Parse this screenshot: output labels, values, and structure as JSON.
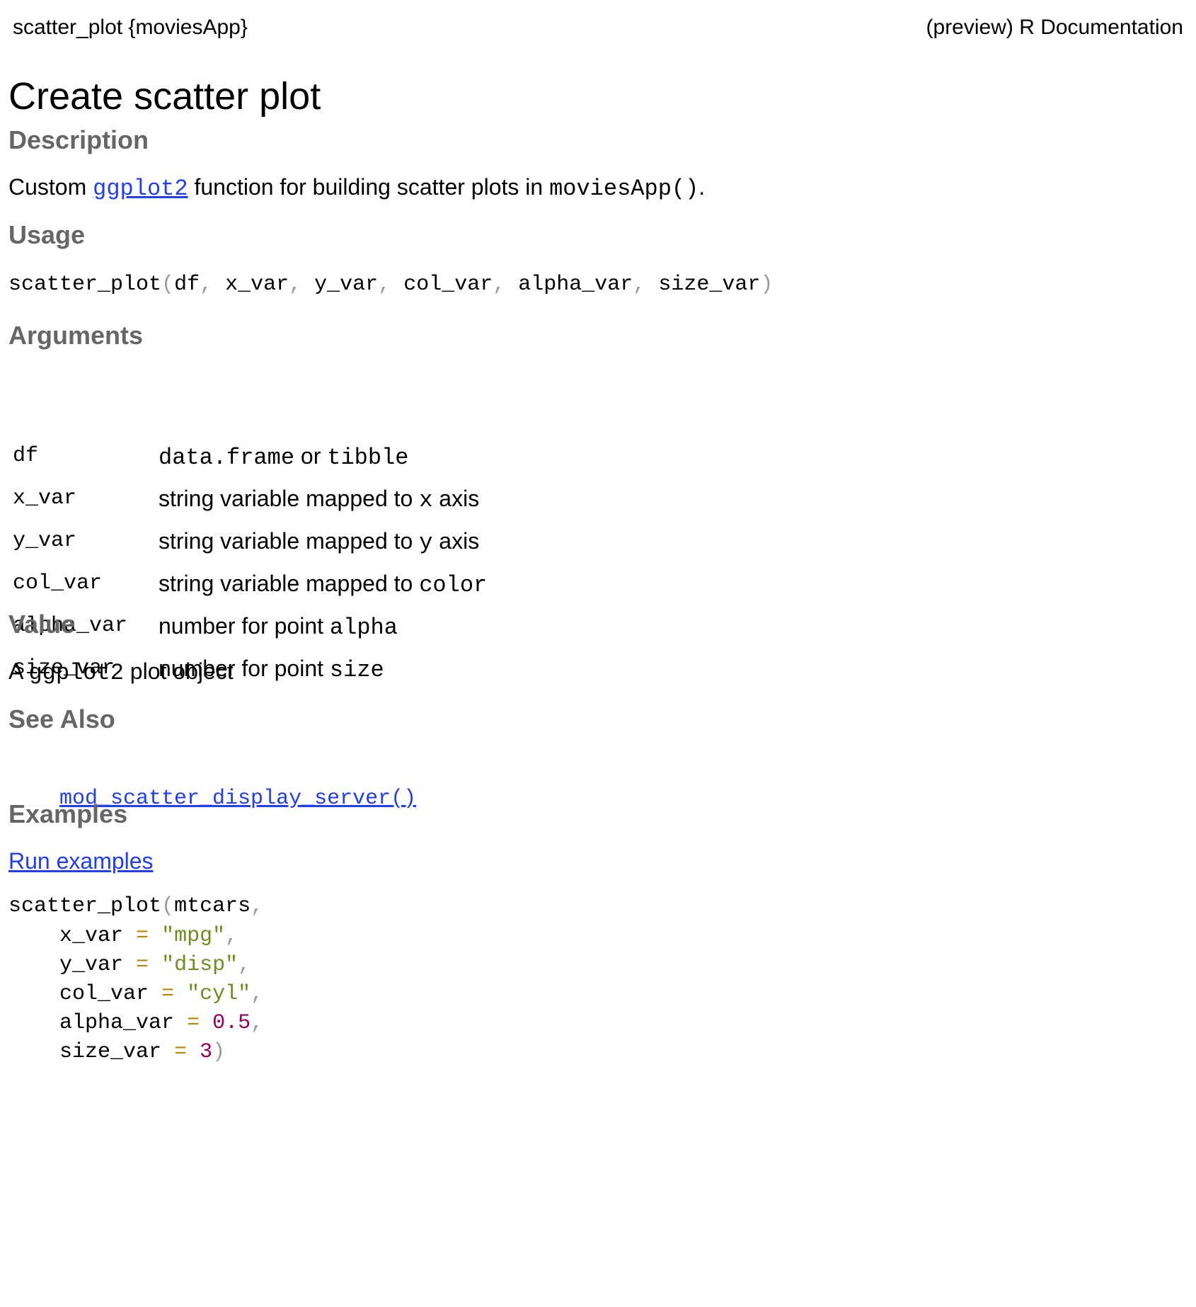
{
  "header": {
    "left": "scatter_plot {moviesApp}",
    "right": "(preview) R Documentation"
  },
  "title": "Create scatter plot",
  "sections": {
    "description": {
      "heading": "Description",
      "text_prefix": "Custom",
      "link": "ggplot2",
      "text_middle": "function for building scatter plots in",
      "code": "moviesApp()",
      "text_suffix": "."
    },
    "usage": {
      "heading": "Usage",
      "function": "scatter_plot",
      "open_paren": "(",
      "close_paren": ")",
      "comma": ",",
      "args": [
        "df",
        "x_var",
        "y_var",
        "col_var",
        "alpha_var",
        "size_var"
      ]
    },
    "arguments": {
      "heading": "Arguments",
      "rows": [
        {
          "name": "df",
          "parts": [
            {
              "text": "data.frame",
              "mono": true
            },
            {
              "text": " or ",
              "mono": false
            },
            {
              "text": "tibble",
              "mono": true
            }
          ]
        },
        {
          "name": "x_var",
          "parts": [
            {
              "text": "string variable mapped to ",
              "mono": false
            },
            {
              "text": "x",
              "mono": true
            },
            {
              "text": " axis",
              "mono": false
            }
          ]
        },
        {
          "name": "y_var",
          "parts": [
            {
              "text": "string variable mapped to ",
              "mono": false
            },
            {
              "text": "y",
              "mono": true
            },
            {
              "text": " axis",
              "mono": false
            }
          ]
        },
        {
          "name": "col_var",
          "parts": [
            {
              "text": "string variable mapped to ",
              "mono": false
            },
            {
              "text": "color",
              "mono": true
            }
          ]
        },
        {
          "name": "alpha_var",
          "parts": [
            {
              "text": "number for point ",
              "mono": false
            },
            {
              "text": "alpha",
              "mono": true
            }
          ]
        },
        {
          "name": "size_var",
          "parts": [
            {
              "text": "number for point ",
              "mono": false
            },
            {
              "text": "size",
              "mono": true
            }
          ]
        }
      ]
    },
    "value": {
      "heading": "Value",
      "text_prefix": "A",
      "code": "ggplot2",
      "text_suffix": "plot object"
    },
    "see_also": {
      "heading": "See Also",
      "link": "mod_scatter_display_server()"
    },
    "examples": {
      "heading": "Examples",
      "run_link": "Run examples",
      "function": "scatter_plot",
      "open_paren": "(",
      "close_paren": ")",
      "comma": ",",
      "first_arg": "mtcars",
      "assignments": [
        {
          "name": "x_var",
          "op": "=",
          "value": "\"mpg\"",
          "value_type": "string",
          "trail": ","
        },
        {
          "name": "y_var",
          "op": "=",
          "value": "\"disp\"",
          "value_type": "string",
          "trail": ","
        },
        {
          "name": "col_var",
          "op": "=",
          "value": "\"cyl\"",
          "value_type": "string",
          "trail": ","
        },
        {
          "name": "alpha_var",
          "op": "=",
          "value": "0.5",
          "value_type": "number",
          "trail": ","
        },
        {
          "name": "size_var",
          "op": "=",
          "value": "3",
          "value_type": "number",
          "trail": ")"
        }
      ]
    }
  },
  "colors": {
    "heading": "#666666",
    "link": "#1f3cff",
    "punctuation": "#9a9a9a",
    "operator": "#b58900",
    "string": "#6a8f1f",
    "number": "#990055"
  }
}
